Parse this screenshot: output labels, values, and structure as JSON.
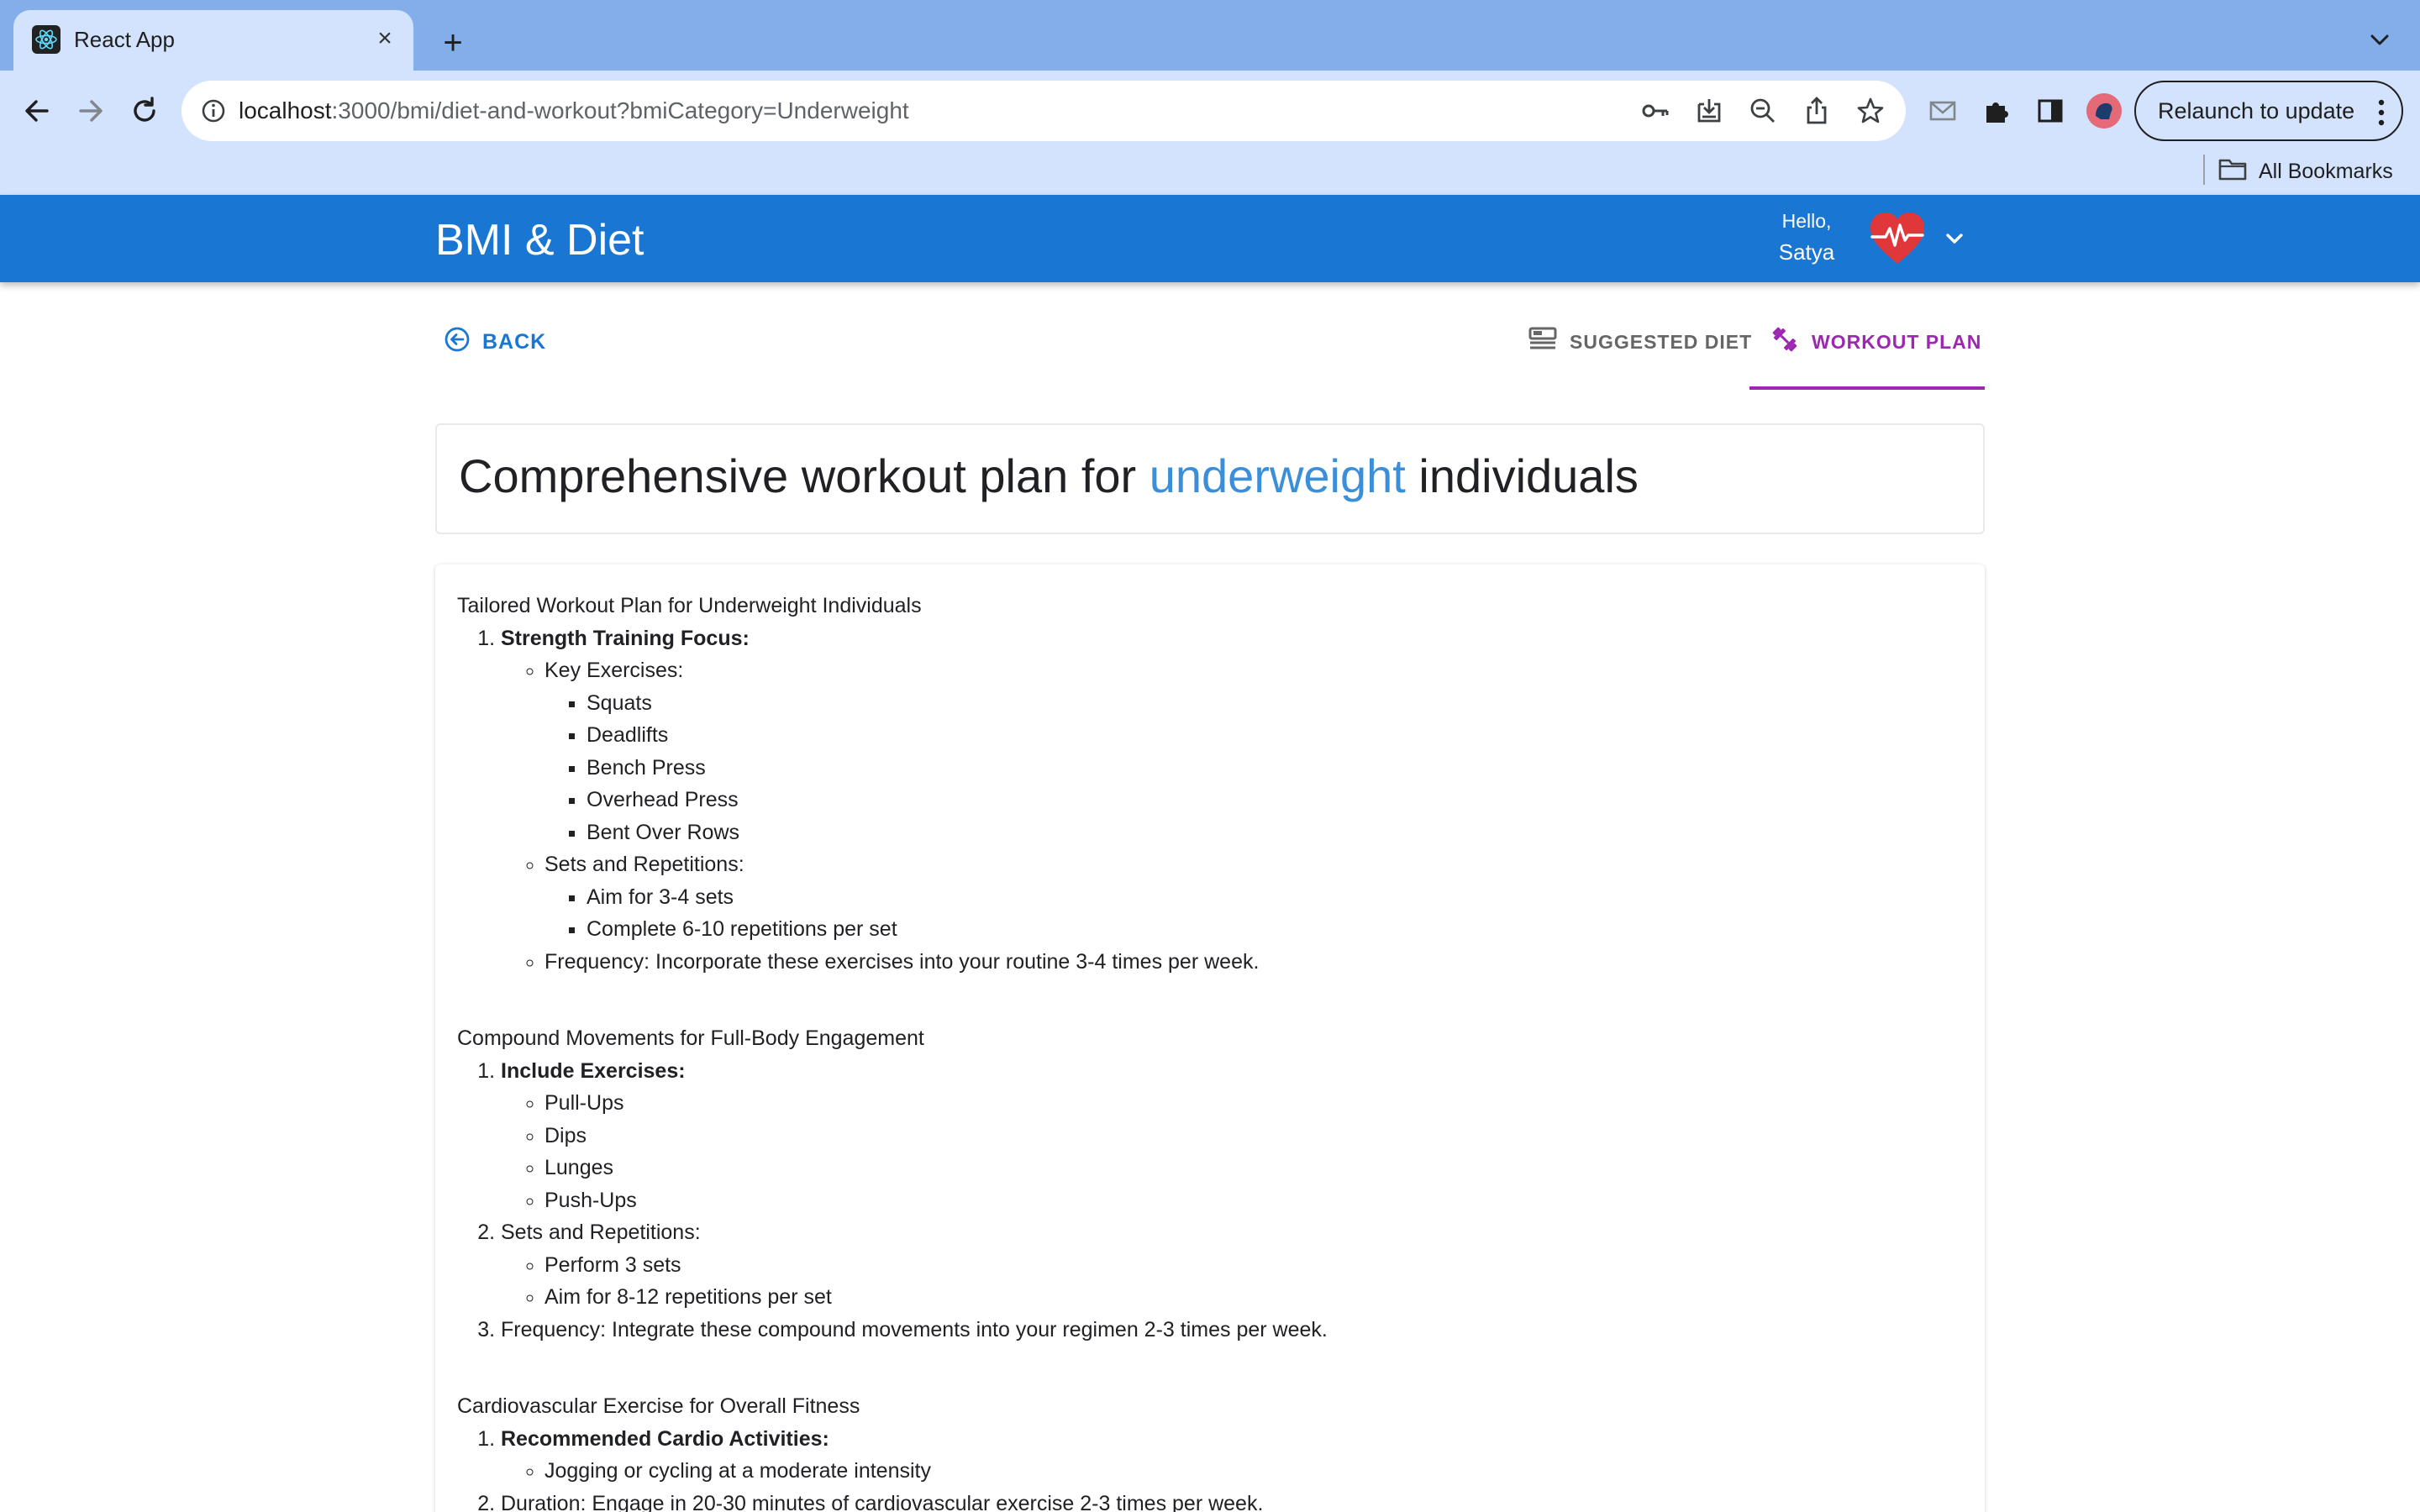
{
  "browser": {
    "tab_title": "React App",
    "url_host": "localhost",
    "url_rest": ":3000/bmi/diet-and-workout?bmiCategory=Underweight",
    "relaunch_label": "Relaunch to update",
    "bookmarks_label": "All Bookmarks"
  },
  "app": {
    "brand": "BMI & Diet",
    "greeting": "Hello,",
    "user_name": "Satya"
  },
  "nav": {
    "back_label": "BACK",
    "tabs": [
      {
        "label": "SUGGESTED DIET",
        "active": false
      },
      {
        "label": "WORKOUT PLAN",
        "active": true
      }
    ]
  },
  "page": {
    "title_prefix": "Comprehensive workout plan for ",
    "title_highlight": "underweight",
    "title_suffix": " individuals"
  },
  "plan": {
    "sections": [
      {
        "title": "Tailored Workout Plan for Underweight Individuals",
        "item1_label": "Strength Training Focus:",
        "key_exercises_label": "Key Exercises:",
        "key_exercises": [
          "Squats",
          "Deadlifts",
          "Bench Press",
          "Overhead Press",
          "Bent Over Rows"
        ],
        "sets_label": "Sets and Repetitions:",
        "sets": [
          "Aim for 3-4 sets",
          "Complete 6-10 repetitions per set"
        ],
        "frequency": "Frequency: Incorporate these exercises into your routine 3-4 times per week."
      },
      {
        "title": "Compound Movements for Full-Body Engagement",
        "item1_label": "Include Exercises:",
        "exercises": [
          "Pull-Ups",
          "Dips",
          "Lunges",
          "Push-Ups"
        ],
        "item2_label": "Sets and Repetitions:",
        "sets": [
          "Perform 3 sets",
          "Aim for 8-12 repetitions per set"
        ],
        "item3": "Frequency: Integrate these compound movements into your regimen 2-3 times per week."
      },
      {
        "title": "Cardiovascular Exercise for Overall Fitness",
        "item1_label": "Recommended Cardio Activities:",
        "activities": [
          "Jogging or cycling at a moderate intensity"
        ],
        "item2": "Duration: Engage in 20-30 minutes of cardiovascular exercise 2-3 times per week."
      }
    ]
  },
  "colors": {
    "appbar": "#1976d2",
    "accent_purple": "#9c27b0",
    "highlight_blue": "#3b8fd8",
    "chrome_tabstrip": "#84aeea",
    "chrome_toolbar": "#d3e3fd"
  }
}
